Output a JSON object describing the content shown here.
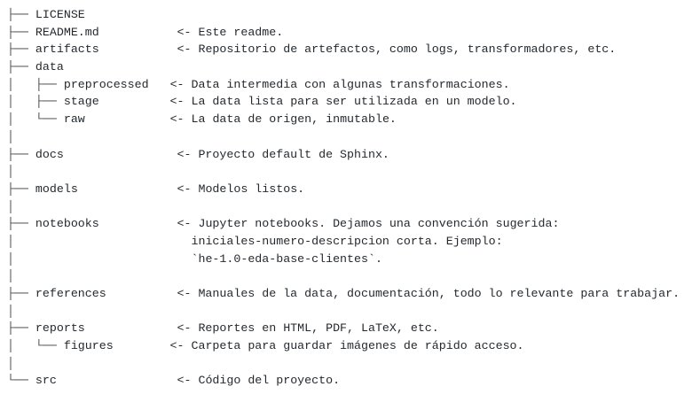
{
  "lines": [
    {
      "prefix": "├── ",
      "name": "LICENSE",
      "pad": "",
      "comment": ""
    },
    {
      "prefix": "├── ",
      "name": "README.md",
      "pad": "           ",
      "comment": "<- Este readme."
    },
    {
      "prefix": "├── ",
      "name": "artifacts",
      "pad": "           ",
      "comment": "<- Repositorio de artefactos, como logs, transformadores, etc."
    },
    {
      "prefix": "├── ",
      "name": "data",
      "pad": "",
      "comment": ""
    },
    {
      "prefix": "│   ├── ",
      "name": "preprocessed",
      "pad": "   ",
      "comment": "<- Data intermedia con algunas transformaciones."
    },
    {
      "prefix": "│   ├── ",
      "name": "stage",
      "pad": "          ",
      "comment": "<- La data lista para ser utilizada en un modelo."
    },
    {
      "prefix": "│   └── ",
      "name": "raw",
      "pad": "            ",
      "comment": "<- La data de origen, inmutable."
    },
    {
      "prefix": "│",
      "name": "",
      "pad": "",
      "comment": ""
    },
    {
      "prefix": "├── ",
      "name": "docs",
      "pad": "                ",
      "comment": "<- Proyecto default de Sphinx."
    },
    {
      "prefix": "│",
      "name": "",
      "pad": "",
      "comment": ""
    },
    {
      "prefix": "├── ",
      "name": "models",
      "pad": "              ",
      "comment": "<- Modelos listos."
    },
    {
      "prefix": "│",
      "name": "",
      "pad": "",
      "comment": ""
    },
    {
      "prefix": "├── ",
      "name": "notebooks",
      "pad": "           ",
      "comment": "<- Jupyter notebooks. Dejamos una convención sugerida:"
    },
    {
      "prefix": "│",
      "name": "",
      "pad": "                         ",
      "comment": "iniciales-numero-descripcion corta. Ejemplo:"
    },
    {
      "prefix": "│",
      "name": "",
      "pad": "                         ",
      "comment": "`he-1.0-eda-base-clientes`."
    },
    {
      "prefix": "│",
      "name": "",
      "pad": "",
      "comment": ""
    },
    {
      "prefix": "├── ",
      "name": "references",
      "pad": "          ",
      "comment": "<- Manuales de la data, documentación, todo lo relevante para trabajar."
    },
    {
      "prefix": "│",
      "name": "",
      "pad": "",
      "comment": ""
    },
    {
      "prefix": "├── ",
      "name": "reports",
      "pad": "             ",
      "comment": "<- Reportes en HTML, PDF, LaTeX, etc."
    },
    {
      "prefix": "│   └── ",
      "name": "figures",
      "pad": "        ",
      "comment": "<- Carpeta para guardar imágenes de rápido acceso."
    },
    {
      "prefix": "│",
      "name": "",
      "pad": "",
      "comment": ""
    },
    {
      "prefix": "└── ",
      "name": "src",
      "pad": "                 ",
      "comment": "<- Código del proyecto."
    }
  ]
}
